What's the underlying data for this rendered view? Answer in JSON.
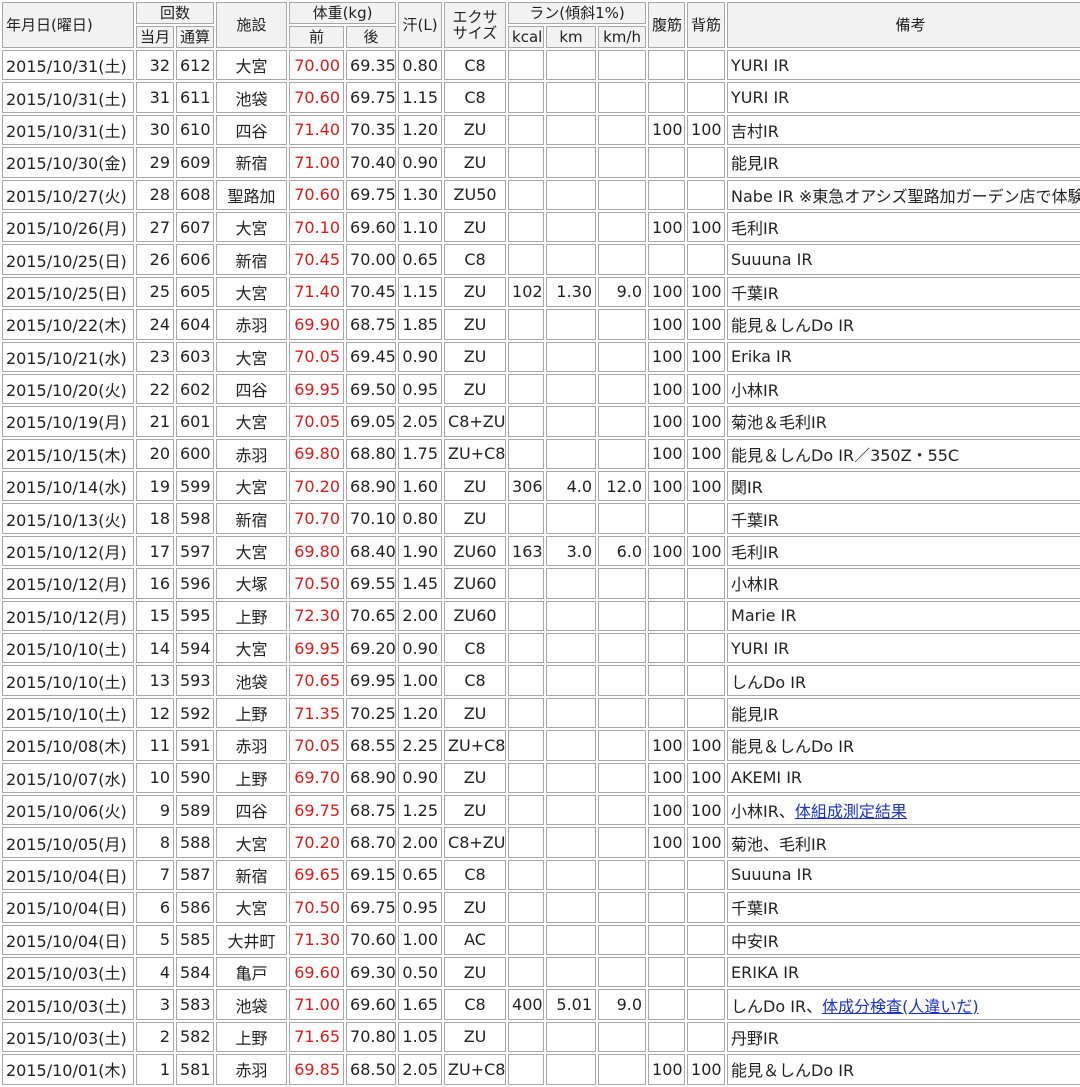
{
  "headers": {
    "date": "年月日(曜日)",
    "count": "回数",
    "count_month": "当月",
    "count_total": "通算",
    "facility": "施設",
    "weight": "体重(kg)",
    "weight_before": "前",
    "weight_after": "後",
    "sweat": "汗(L)",
    "exercise": "エクササイズ",
    "run": "ラン(傾斜1%)",
    "run_kcal": "kcal",
    "run_km": "km",
    "run_kmh": "km/h",
    "abs": "腹筋",
    "back": "背筋",
    "notes": "備考"
  },
  "rows": [
    {
      "date": "2015/10/31(土)",
      "month": "32",
      "total": "612",
      "facility": "大宮",
      "before": "70.00",
      "after": "69.35",
      "sweat": "0.80",
      "exercise": "C8",
      "kcal": "",
      "km": "",
      "kmh": "",
      "abs": "",
      "back": "",
      "note": "YURI IR",
      "link": ""
    },
    {
      "date": "2015/10/31(土)",
      "month": "31",
      "total": "611",
      "facility": "池袋",
      "before": "70.60",
      "after": "69.75",
      "sweat": "1.15",
      "exercise": "C8",
      "kcal": "",
      "km": "",
      "kmh": "",
      "abs": "",
      "back": "",
      "note": "YURI IR",
      "link": ""
    },
    {
      "date": "2015/10/31(土)",
      "month": "30",
      "total": "610",
      "facility": "四谷",
      "before": "71.40",
      "after": "70.35",
      "sweat": "1.20",
      "exercise": "ZU",
      "kcal": "",
      "km": "",
      "kmh": "",
      "abs": "100",
      "back": "100",
      "note": "吉村IR",
      "link": ""
    },
    {
      "date": "2015/10/30(金)",
      "month": "29",
      "total": "609",
      "facility": "新宿",
      "before": "71.00",
      "after": "70.40",
      "sweat": "0.90",
      "exercise": "ZU",
      "kcal": "",
      "km": "",
      "kmh": "",
      "abs": "",
      "back": "",
      "note": "能見IR",
      "link": "",
      "highlight": true
    },
    {
      "date": "2015/10/27(火)",
      "month": "28",
      "total": "608",
      "facility": "聖路加",
      "before": "70.60",
      "after": "69.75",
      "sweat": "1.30",
      "exercise": "ZU50",
      "kcal": "",
      "km": "",
      "kmh": "",
      "abs": "",
      "back": "",
      "note": "Nabe IR ※東急オアシズ聖路加ガーデン店で体験",
      "link": ""
    },
    {
      "date": "2015/10/26(月)",
      "month": "27",
      "total": "607",
      "facility": "大宮",
      "before": "70.10",
      "after": "69.60",
      "sweat": "1.10",
      "exercise": "ZU",
      "kcal": "",
      "km": "",
      "kmh": "",
      "abs": "100",
      "back": "100",
      "note": "毛利IR",
      "link": ""
    },
    {
      "date": "2015/10/25(日)",
      "month": "26",
      "total": "606",
      "facility": "新宿",
      "before": "70.45",
      "after": "70.00",
      "sweat": "0.65",
      "exercise": "C8",
      "kcal": "",
      "km": "",
      "kmh": "",
      "abs": "",
      "back": "",
      "note": "Suuuna IR",
      "link": ""
    },
    {
      "date": "2015/10/25(日)",
      "month": "25",
      "total": "605",
      "facility": "大宮",
      "before": "71.40",
      "after": "70.45",
      "sweat": "1.15",
      "exercise": "ZU",
      "kcal": "102",
      "km": "1.30",
      "kmh": "9.0",
      "abs": "100",
      "back": "100",
      "note": "千葉IR",
      "link": ""
    },
    {
      "date": "2015/10/22(木)",
      "month": "24",
      "total": "604",
      "facility": "赤羽",
      "before": "69.90",
      "after": "68.75",
      "sweat": "1.85",
      "exercise": "ZU",
      "kcal": "",
      "km": "",
      "kmh": "",
      "abs": "100",
      "back": "100",
      "note": "能見＆しんDo IR",
      "link": ""
    },
    {
      "date": "2015/10/21(水)",
      "month": "23",
      "total": "603",
      "facility": "大宮",
      "before": "70.05",
      "after": "69.45",
      "sweat": "0.90",
      "exercise": "ZU",
      "kcal": "",
      "km": "",
      "kmh": "",
      "abs": "100",
      "back": "100",
      "note": "Erika IR",
      "link": ""
    },
    {
      "date": "2015/10/20(火)",
      "month": "22",
      "total": "602",
      "facility": "四谷",
      "before": "69.95",
      "after": "69.50",
      "sweat": "0.95",
      "exercise": "ZU",
      "kcal": "",
      "km": "",
      "kmh": "",
      "abs": "100",
      "back": "100",
      "note": "小林IR",
      "link": ""
    },
    {
      "date": "2015/10/19(月)",
      "month": "21",
      "total": "601",
      "facility": "大宮",
      "before": "70.05",
      "after": "69.05",
      "sweat": "2.05",
      "exercise": "C8+ZU",
      "kcal": "",
      "km": "",
      "kmh": "",
      "abs": "100",
      "back": "100",
      "note": "菊池＆毛利IR",
      "link": ""
    },
    {
      "date": "2015/10/15(木)",
      "month": "20",
      "total": "600",
      "facility": "赤羽",
      "before": "69.80",
      "after": "68.80",
      "sweat": "1.75",
      "exercise": "ZU+C8",
      "kcal": "",
      "km": "",
      "kmh": "",
      "abs": "100",
      "back": "100",
      "note": "能見＆しんDo IR／350Z・55C",
      "link": ""
    },
    {
      "date": "2015/10/14(水)",
      "month": "19",
      "total": "599",
      "facility": "大宮",
      "before": "70.20",
      "after": "68.90",
      "sweat": "1.60",
      "exercise": "ZU",
      "kcal": "306",
      "km": "4.0",
      "kmh": "12.0",
      "abs": "100",
      "back": "100",
      "note": "関IR",
      "link": ""
    },
    {
      "date": "2015/10/13(火)",
      "month": "18",
      "total": "598",
      "facility": "新宿",
      "before": "70.70",
      "after": "70.10",
      "sweat": "0.80",
      "exercise": "ZU",
      "kcal": "",
      "km": "",
      "kmh": "",
      "abs": "",
      "back": "",
      "note": "千葉IR",
      "link": ""
    },
    {
      "date": "2015/10/12(月)",
      "month": "17",
      "total": "597",
      "facility": "大宮",
      "before": "69.80",
      "after": "68.40",
      "sweat": "1.90",
      "exercise": "ZU60",
      "kcal": "163",
      "km": "3.0",
      "kmh": "6.0",
      "abs": "100",
      "back": "100",
      "note": "毛利IR",
      "link": ""
    },
    {
      "date": "2015/10/12(月)",
      "month": "16",
      "total": "596",
      "facility": "大塚",
      "before": "70.50",
      "after": "69.55",
      "sweat": "1.45",
      "exercise": "ZU60",
      "kcal": "",
      "km": "",
      "kmh": "",
      "abs": "",
      "back": "",
      "note": "小林IR",
      "link": ""
    },
    {
      "date": "2015/10/12(月)",
      "month": "15",
      "total": "595",
      "facility": "上野",
      "before": "72.30",
      "after": "70.65",
      "sweat": "2.00",
      "exercise": "ZU60",
      "kcal": "",
      "km": "",
      "kmh": "",
      "abs": "",
      "back": "",
      "note": "Marie IR",
      "link": ""
    },
    {
      "date": "2015/10/10(土)",
      "month": "14",
      "total": "594",
      "facility": "大宮",
      "before": "69.95",
      "after": "69.20",
      "sweat": "0.90",
      "exercise": "C8",
      "kcal": "",
      "km": "",
      "kmh": "",
      "abs": "",
      "back": "",
      "note": "YURI IR",
      "link": ""
    },
    {
      "date": "2015/10/10(土)",
      "month": "13",
      "total": "593",
      "facility": "池袋",
      "before": "70.65",
      "after": "69.95",
      "sweat": "1.00",
      "exercise": "C8",
      "kcal": "",
      "km": "",
      "kmh": "",
      "abs": "",
      "back": "",
      "note": "しんDo IR",
      "link": ""
    },
    {
      "date": "2015/10/10(土)",
      "month": "12",
      "total": "592",
      "facility": "上野",
      "before": "71.35",
      "after": "70.25",
      "sweat": "1.20",
      "exercise": "ZU",
      "kcal": "",
      "km": "",
      "kmh": "",
      "abs": "",
      "back": "",
      "note": "能見IR",
      "link": ""
    },
    {
      "date": "2015/10/08(木)",
      "month": "11",
      "total": "591",
      "facility": "赤羽",
      "before": "70.05",
      "after": "68.55",
      "sweat": "2.25",
      "exercise": "ZU+C8",
      "kcal": "",
      "km": "",
      "kmh": "",
      "abs": "100",
      "back": "100",
      "note": "能見＆しんDo IR",
      "link": ""
    },
    {
      "date": "2015/10/07(水)",
      "month": "10",
      "total": "590",
      "facility": "上野",
      "before": "69.70",
      "after": "68.90",
      "sweat": "0.90",
      "exercise": "ZU",
      "kcal": "",
      "km": "",
      "kmh": "",
      "abs": "100",
      "back": "100",
      "note": "AKEMI IR",
      "link": ""
    },
    {
      "date": "2015/10/06(火)",
      "month": "9",
      "total": "589",
      "facility": "四谷",
      "before": "69.75",
      "after": "68.75",
      "sweat": "1.25",
      "exercise": "ZU",
      "kcal": "",
      "km": "",
      "kmh": "",
      "abs": "100",
      "back": "100",
      "note": "小林IR、",
      "link": "体組成測定結果"
    },
    {
      "date": "2015/10/05(月)",
      "month": "8",
      "total": "588",
      "facility": "大宮",
      "before": "70.20",
      "after": "68.70",
      "sweat": "2.00",
      "exercise": "C8+ZU",
      "kcal": "",
      "km": "",
      "kmh": "",
      "abs": "100",
      "back": "100",
      "note": "菊池、毛利IR",
      "link": ""
    },
    {
      "date": "2015/10/04(日)",
      "month": "7",
      "total": "587",
      "facility": "新宿",
      "before": "69.65",
      "after": "69.15",
      "sweat": "0.65",
      "exercise": "C8",
      "kcal": "",
      "km": "",
      "kmh": "",
      "abs": "",
      "back": "",
      "note": "Suuuna IR",
      "link": ""
    },
    {
      "date": "2015/10/04(日)",
      "month": "6",
      "total": "586",
      "facility": "大宮",
      "before": "70.50",
      "after": "69.75",
      "sweat": "0.95",
      "exercise": "ZU",
      "kcal": "",
      "km": "",
      "kmh": "",
      "abs": "",
      "back": "",
      "note": "千葉IR",
      "link": ""
    },
    {
      "date": "2015/10/04(日)",
      "month": "5",
      "total": "585",
      "facility": "大井町",
      "before": "71.30",
      "after": "70.60",
      "sweat": "1.00",
      "exercise": "AC",
      "kcal": "",
      "km": "",
      "kmh": "",
      "abs": "",
      "back": "",
      "note": "中安IR",
      "link": ""
    },
    {
      "date": "2015/10/03(土)",
      "month": "4",
      "total": "584",
      "facility": "亀戸",
      "before": "69.60",
      "after": "69.30",
      "sweat": "0.50",
      "exercise": "ZU",
      "kcal": "",
      "km": "",
      "kmh": "",
      "abs": "",
      "back": "",
      "note": "ERIKA IR",
      "link": ""
    },
    {
      "date": "2015/10/03(土)",
      "month": "3",
      "total": "583",
      "facility": "池袋",
      "before": "71.00",
      "after": "69.60",
      "sweat": "1.65",
      "exercise": "C8",
      "kcal": "400",
      "km": "5.01",
      "kmh": "9.0",
      "abs": "",
      "back": "",
      "note": "しんDo IR、",
      "link": "体成分検査(人違いだ)"
    },
    {
      "date": "2015/10/03(土)",
      "month": "2",
      "total": "582",
      "facility": "上野",
      "before": "71.65",
      "after": "70.80",
      "sweat": "1.05",
      "exercise": "ZU",
      "kcal": "",
      "km": "",
      "kmh": "",
      "abs": "",
      "back": "",
      "note": "丹野IR",
      "link": ""
    },
    {
      "date": "2015/10/01(木)",
      "month": "1",
      "total": "581",
      "facility": "赤羽",
      "before": "69.85",
      "after": "68.50",
      "sweat": "2.05",
      "exercise": "ZU+C8",
      "kcal": "",
      "km": "",
      "kmh": "",
      "abs": "100",
      "back": "100",
      "note": "能見＆しんDo IR",
      "link": ""
    }
  ]
}
